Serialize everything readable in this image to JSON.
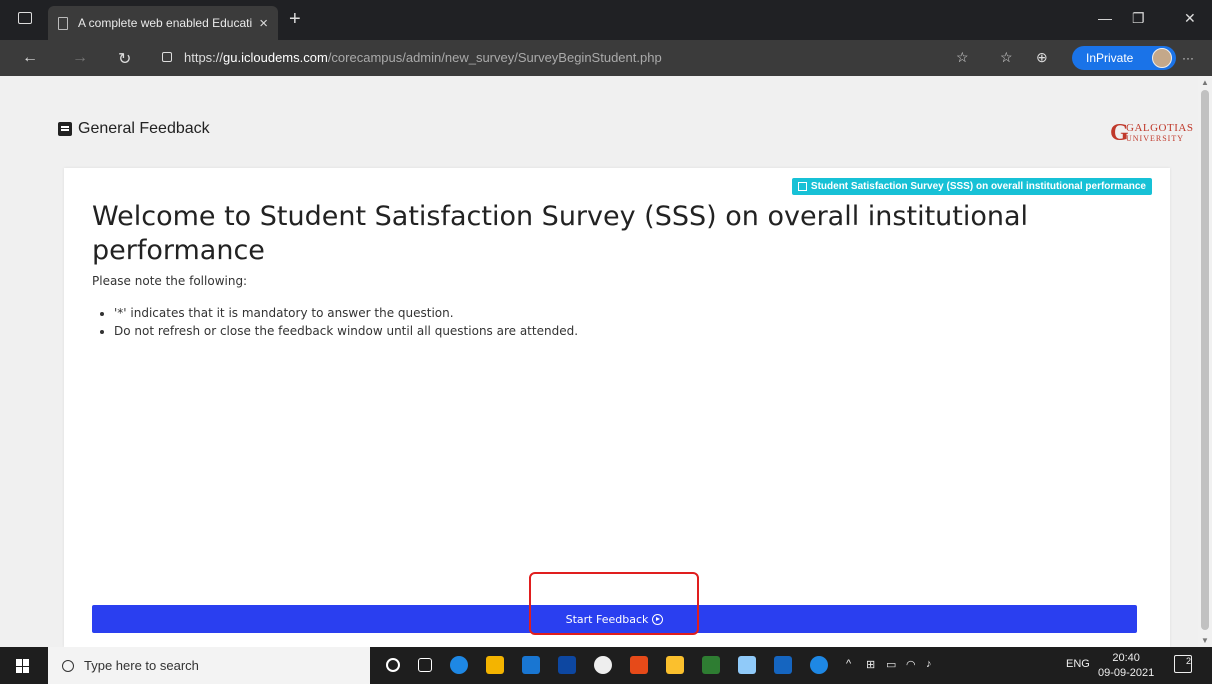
{
  "browser": {
    "tab_title": "A complete web enabled Educati",
    "tab_close": "×",
    "new_tab": "+",
    "url_scheme": "https://",
    "url_host": "gu.icloudems.com",
    "url_path": "/corecampus/admin/new_survey/SurveyBeginStudent.php",
    "inprivate_label": "InPrivate",
    "more_label": "···",
    "minimize": "—",
    "maximize": "❐",
    "close": "✕",
    "back": "←",
    "forward": "→",
    "refresh": "↻",
    "read_aloud": "☆",
    "favorites": "☆",
    "collections": "⊕"
  },
  "page": {
    "header_title": "General Feedback",
    "logo_name": "GALGOTIAS",
    "logo_sub": "UNIVERSITY",
    "badge_label": "Student Satisfaction Survey (SSS) on overall institutional performance",
    "welcome_title": "Welcome to Student Satisfaction Survey (SSS) on overall institutional performance",
    "note": "Please note the following:",
    "rules": [
      "'*' indicates that it is mandatory to answer the question.",
      "Do not refresh or close the feedback window until all questions are attended."
    ],
    "start_button": "Start Feedback"
  },
  "taskbar": {
    "search_placeholder": "Type here to search",
    "language": "ENG",
    "time": "20:40",
    "date": "09-09-2021",
    "notifications": "2"
  },
  "colors": {
    "primary_button": "#2a3ff0",
    "badge": "#17c1d6",
    "highlight": "#e01e1e",
    "inprivate": "#1a73e8"
  }
}
